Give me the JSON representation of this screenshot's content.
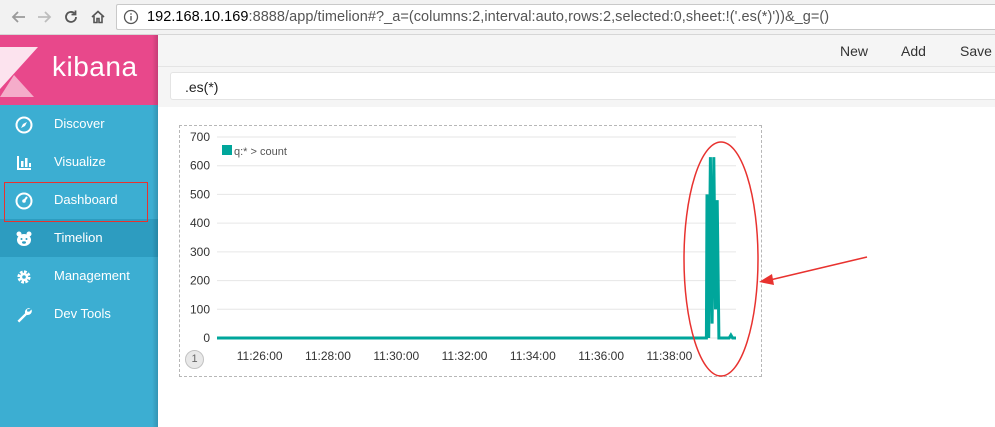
{
  "browser": {
    "back_icon": "arrow-left-icon",
    "forward_icon": "arrow-right-icon",
    "reload_icon": "reload-icon",
    "home_icon": "home-icon",
    "info_icon": "info-icon",
    "url_host": "192.168.10.169",
    "url_rest": ":8888/app/timelion#?_a=(columns:2,interval:auto,rows:2,selected:0,sheet:!('.es(*)'))&_g=()"
  },
  "sidebar": {
    "brand": "kibana",
    "items": [
      {
        "label": "Discover",
        "icon": "compass-icon"
      },
      {
        "label": "Visualize",
        "icon": "bar-chart-icon"
      },
      {
        "label": "Dashboard",
        "icon": "dashboard-gauge-icon"
      },
      {
        "label": "Timelion",
        "icon": "timelion-bear-icon"
      },
      {
        "label": "Management",
        "icon": "gear-icon"
      },
      {
        "label": "Dev Tools",
        "icon": "wrench-icon"
      }
    ],
    "active_index": 3
  },
  "topmenu": {
    "new_label": "New",
    "add_label": "Add",
    "save_label": "Save"
  },
  "query": {
    "expression": ".es(*)"
  },
  "sheet": {
    "number": "1"
  },
  "colors": {
    "series": "#00a69b",
    "annotation": "#e8322f",
    "sidebar": "#3caed2",
    "logo": "#e8488b"
  },
  "chart_data": {
    "type": "line",
    "legend": "q:* > count",
    "legend_position": "top-left",
    "y_ticks": [
      0,
      100,
      200,
      300,
      400,
      500,
      600,
      700
    ],
    "ylim": [
      0,
      700
    ],
    "x_ticks": [
      "11:26:00",
      "11:28:00",
      "11:30:00",
      "11:32:00",
      "11:34:00",
      "11:36:00",
      "11:38:00"
    ],
    "grid": true,
    "series": [
      {
        "name": "q:* > count",
        "x": [
          "11:24:45",
          "11:39:05",
          "11:39:06",
          "11:39:09",
          "11:39:12",
          "11:39:15",
          "11:39:18",
          "11:39:21",
          "11:39:24",
          "11:39:27",
          "11:39:30",
          "11:39:33",
          "11:39:36",
          "11:39:39",
          "11:39:45",
          "11:39:48",
          "11:39:51",
          "11:39:57"
        ],
        "values": [
          0,
          0,
          500,
          0,
          630,
          50,
          630,
          100,
          480,
          0,
          0,
          0,
          0,
          0,
          0,
          10,
          0,
          0
        ]
      }
    ]
  }
}
